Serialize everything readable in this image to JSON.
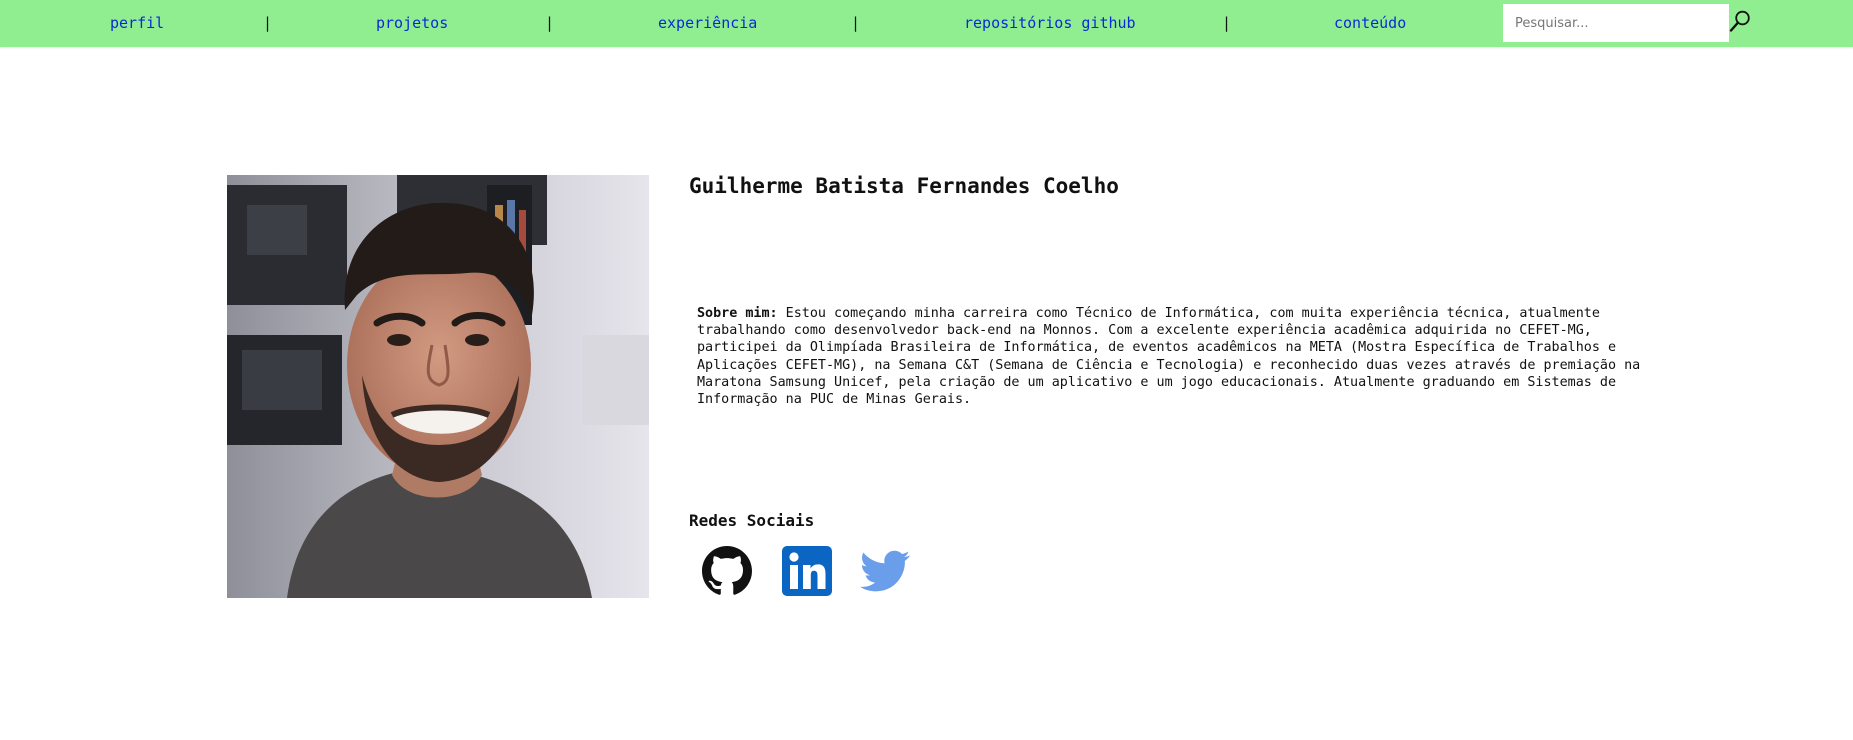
{
  "nav": {
    "items": [
      "perfil",
      "projetos",
      "experiência",
      "repositórios github",
      "conteúdo"
    ],
    "separator": "|",
    "link_color": "#0a2ad8",
    "background_color": "#90ee90"
  },
  "search": {
    "placeholder": "Pesquisar...",
    "value": "",
    "icon": "magnifier-icon"
  },
  "profile": {
    "photo_icon": "profile-photo",
    "name": "Guilherme Batista Fernandes Coelho",
    "about_label": "Sobre mim:",
    "about_text": " Estou começando minha carreira como Técnico de Informática, com muita experiência técnica, atualmente trabalhando como desenvolvedor back-end na Monnos. Com a excelente experiência acadêmica adquirida no CEFET-MG, participei da Olimpíada Brasileira de Informática, de eventos acadêmicos na META (Mostra Específica de Trabalhos e Aplicações CEFET-MG), na Semana C&T (Semana de Ciência e Tecnologia) e reconhecido duas vezes através de premiação na Maratona Samsung Unicef, pela criação de um aplicativo e um jogo educacionais. Atualmente graduando em Sistemas de Informação na PUC de Minas Gerais."
  },
  "social": {
    "heading": "Redes Sociais",
    "links": [
      {
        "icon": "github-icon",
        "color": "#111111"
      },
      {
        "icon": "linkedin-icon",
        "color": "#0a66c2"
      },
      {
        "icon": "twitter-icon",
        "color": "#6b9eea"
      }
    ]
  }
}
